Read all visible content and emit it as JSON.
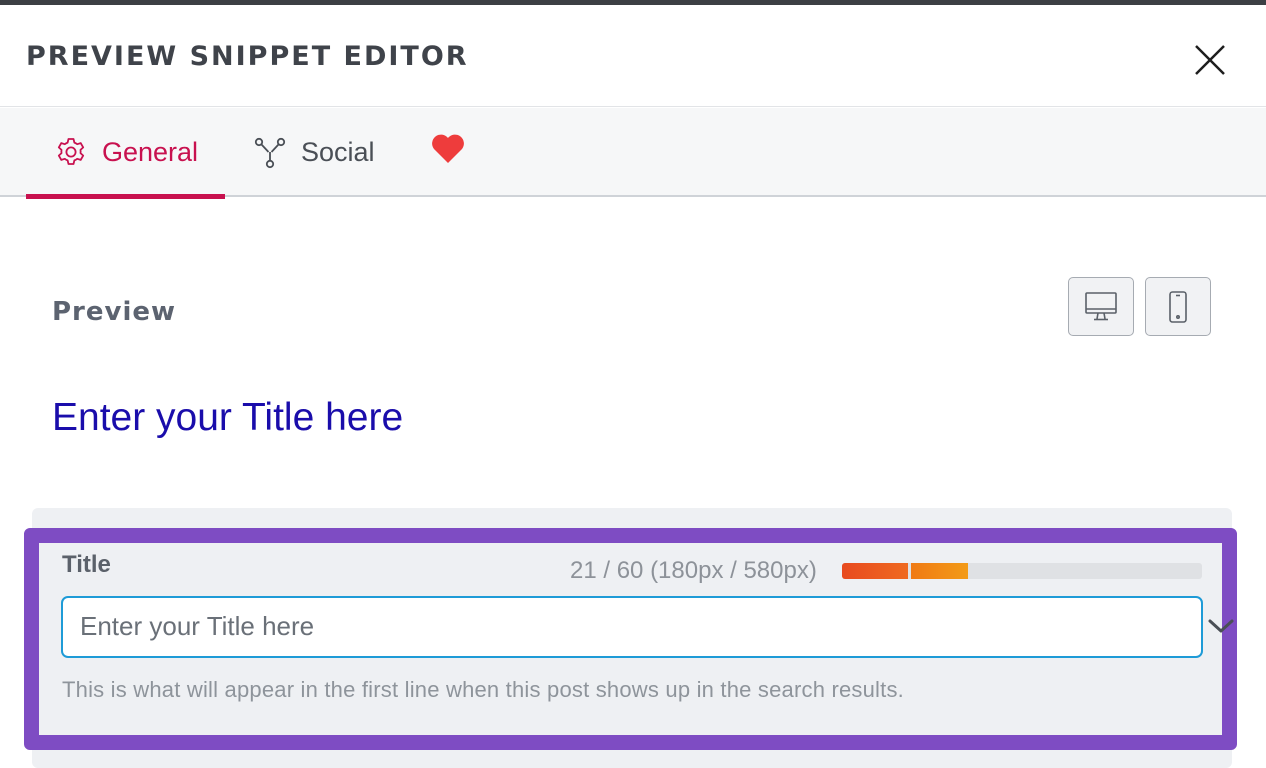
{
  "header": {
    "title": "PREVIEW SNIPPET EDITOR"
  },
  "tabs": [
    {
      "label": "General",
      "icon": "gear-icon",
      "active": true
    },
    {
      "label": "Social",
      "icon": "share-nodes-icon",
      "active": false
    },
    {
      "label": "",
      "icon": "heart-icon",
      "active": false
    }
  ],
  "preview": {
    "label": "Preview",
    "devices": [
      "desktop-icon",
      "mobile-icon"
    ],
    "title": "Enter your Title here"
  },
  "title_field": {
    "label": "Title",
    "count": "21 / 60 (180px / 580px)",
    "length_fill": 0.35,
    "placeholder": "Enter your Title here",
    "help": "This is what will appear in the first line when this post shows up in the search results."
  },
  "colors": {
    "accent": "#c8114f",
    "highlight": "#7e4cc3",
    "link_title": "#1a0dab",
    "input_focus": "#1e9bd7",
    "heart": "#ee3c3c"
  }
}
